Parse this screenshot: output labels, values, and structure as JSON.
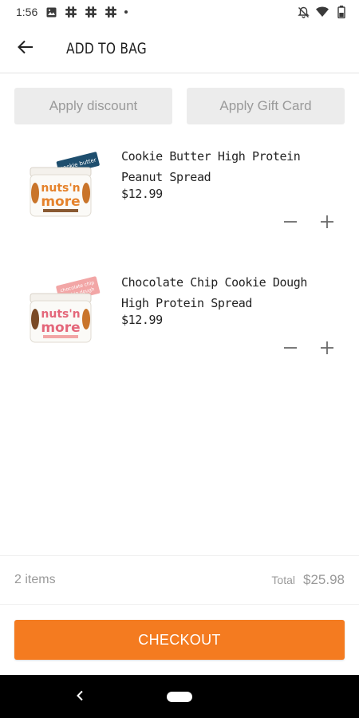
{
  "status_bar": {
    "time": "1:56",
    "left_icons": [
      "image-icon",
      "slack-icon",
      "slack-icon",
      "slack-icon",
      "notification-dot-icon"
    ],
    "right_icons": [
      "bell-off-icon",
      "wifi-icon",
      "battery-icon"
    ]
  },
  "header": {
    "title": "ADD TO BAG",
    "back_icon": "arrow-left-icon"
  },
  "promo": {
    "discount_label": "Apply discount",
    "gift_card_label": "Apply Gift Card"
  },
  "items": [
    {
      "name": "Cookie Butter High Protein Peanut Spread",
      "price": "$12.99",
      "image_brand": "nuts'n more",
      "image_tag": "cookie butter",
      "tag_color": "#1e4e6e"
    },
    {
      "name": "Chocolate Chip Cookie Dough High Protein Spread",
      "price": "$12.99",
      "image_brand": "nuts'n more",
      "image_tag": "chocolate chip cookie dough",
      "tag_color": "#f2a6a6"
    }
  ],
  "summary": {
    "items_count": "2 items",
    "total_label": "Total",
    "total_value": "$25.98"
  },
  "checkout": {
    "label": "CHECKOUT",
    "color": "#f47b20"
  },
  "nav_bar": {
    "back_icon": "chevron-left-icon",
    "home_icon": "home-pill-icon"
  }
}
